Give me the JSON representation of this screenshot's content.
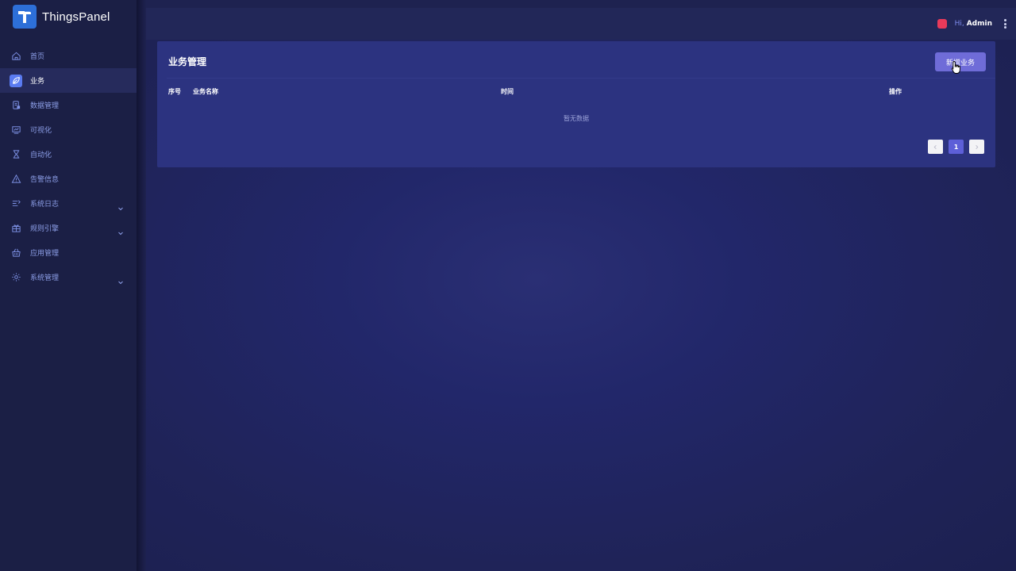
{
  "app": {
    "name": "ThingsPanel"
  },
  "sidebar": {
    "items": [
      {
        "label": "首页",
        "icon": "home-icon"
      },
      {
        "label": "业务",
        "icon": "leaf-icon"
      },
      {
        "label": "数据管理",
        "icon": "data-icon"
      },
      {
        "label": "可视化",
        "icon": "monitor-icon"
      },
      {
        "label": "自动化",
        "icon": "hourglass-icon"
      },
      {
        "label": "告警信息",
        "icon": "warning-icon"
      },
      {
        "label": "系统日志",
        "icon": "log-icon"
      },
      {
        "label": "规则引擎",
        "icon": "gift-icon"
      },
      {
        "label": "应用管理",
        "icon": "basket-icon"
      },
      {
        "label": "系统管理",
        "icon": "gear-icon"
      }
    ],
    "active_index": 1
  },
  "header": {
    "greeting": "Hi,",
    "username": "Admin"
  },
  "card": {
    "title": "业务管理",
    "add_button": "新增业务",
    "columns": {
      "index": "序号",
      "name": "业务名称",
      "time": "时间",
      "actions": "操作"
    },
    "empty_text": "暂无数据"
  },
  "pagination": {
    "current_page": "1"
  },
  "colors": {
    "sidebar_bg": "#1b1f45",
    "accent": "#5d5fd8",
    "card_bg": "#2c3380",
    "avatar": "#e83a5a"
  }
}
